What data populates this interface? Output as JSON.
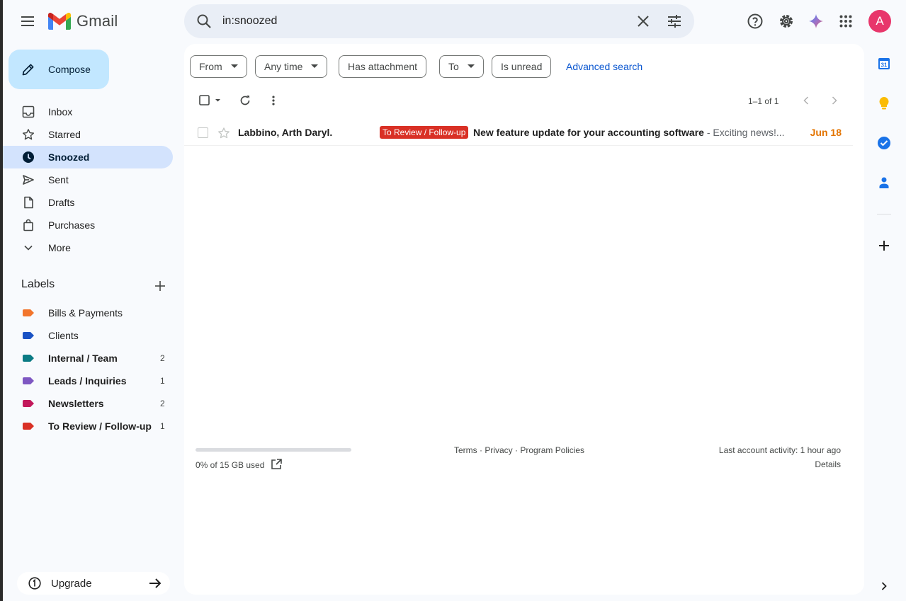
{
  "app": {
    "name": "Gmail"
  },
  "search": {
    "query": "in:snoozed"
  },
  "compose": {
    "label": "Compose"
  },
  "nav": [
    {
      "label": "Inbox",
      "icon": "inbox-icon"
    },
    {
      "label": "Starred",
      "icon": "star-icon"
    },
    {
      "label": "Snoozed",
      "icon": "clock-icon",
      "active": true
    },
    {
      "label": "Sent",
      "icon": "send-icon"
    },
    {
      "label": "Drafts",
      "icon": "draft-icon"
    },
    {
      "label": "Purchases",
      "icon": "shopping-bag-icon"
    },
    {
      "label": "More",
      "icon": "chevron-down-icon"
    }
  ],
  "labels": {
    "title": "Labels",
    "items": [
      {
        "name": "Bills & Payments",
        "color": "#f2752c",
        "count": "",
        "bold": false
      },
      {
        "name": "Clients",
        "color": "#1a52c4",
        "count": "",
        "bold": false
      },
      {
        "name": "Internal / Team",
        "color": "#0b7b84",
        "count": "2",
        "bold": true
      },
      {
        "name": "Leads / Inquiries",
        "color": "#7e57c2",
        "count": "1",
        "bold": true
      },
      {
        "name": "Newsletters",
        "color": "#c2185b",
        "count": "2",
        "bold": true
      },
      {
        "name": "To Review / Follow-up",
        "color": "#d93025",
        "count": "1",
        "bold": true
      }
    ]
  },
  "upgrade": {
    "label": "Upgrade"
  },
  "filters": {
    "chips": [
      "From",
      "Any time",
      "Has attachment",
      "To",
      "Is unread"
    ],
    "advanced": "Advanced search"
  },
  "pager": {
    "text": "1–1 of 1"
  },
  "emails": [
    {
      "sender": "Labbino, Arth Daryl.",
      "label": "To Review / Follow-up",
      "label_color": "#d93025",
      "subject": "New feature update for your accounting software",
      "snippet": " - Exciting news!...",
      "date": "Jun 18"
    }
  ],
  "footer": {
    "storage": "0% of 15 GB used",
    "links": [
      "Terms",
      "Privacy",
      "Program Policies"
    ],
    "activity": "Last account activity: 1 hour ago",
    "details": "Details"
  },
  "side_apps": {
    "calendar_day": "31"
  }
}
